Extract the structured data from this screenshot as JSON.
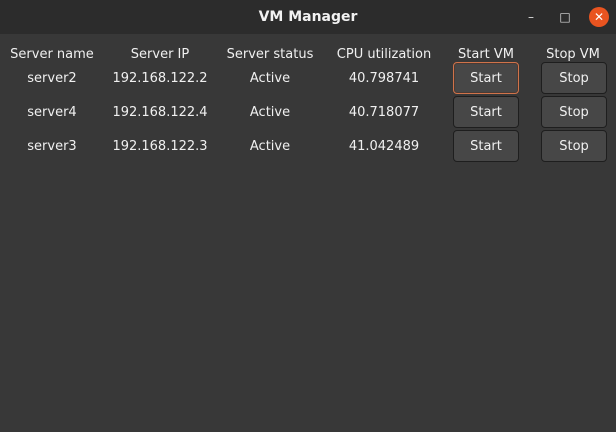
{
  "window": {
    "title": "VM Manager",
    "controls": {
      "minimize_glyph": "–",
      "maximize_glyph": "□",
      "close_glyph": "✕"
    }
  },
  "table": {
    "headers": [
      "Server name",
      "Server IP",
      "Server status",
      "CPU utilization",
      "Start VM",
      "Stop VM"
    ],
    "rows": [
      {
        "name": "server2",
        "ip": "192.168.122.2",
        "status": "Active",
        "cpu": "40.798741",
        "start_label": "Start",
        "stop_label": "Stop"
      },
      {
        "name": "server4",
        "ip": "192.168.122.4",
        "status": "Active",
        "cpu": "40.718077",
        "start_label": "Start",
        "stop_label": "Stop"
      },
      {
        "name": "server3",
        "ip": "192.168.122.3",
        "status": "Active",
        "cpu": "41.042489",
        "start_label": "Start",
        "stop_label": "Stop"
      }
    ]
  },
  "colors": {
    "titlebar": "#2c2c2c",
    "background": "#383838",
    "button": "#474747",
    "focus_border": "#d0734a",
    "close_button": "#e95420"
  }
}
